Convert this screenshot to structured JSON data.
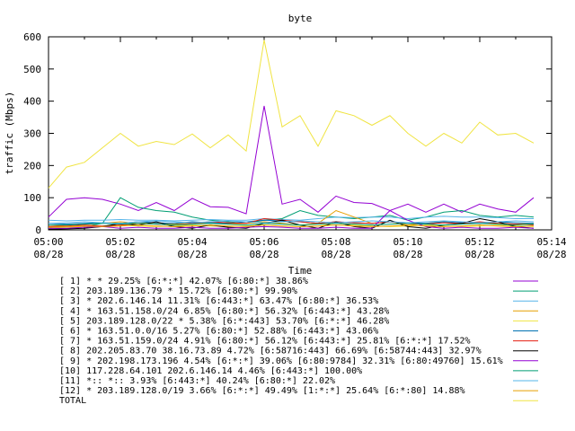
{
  "chart_data": {
    "type": "line",
    "title": "byte",
    "xlabel": "Time",
    "ylabel": "traffic (Mbps)",
    "ylim": [
      0,
      600
    ],
    "xlim": [
      0,
      14
    ],
    "grid": false,
    "legend_placement": "bottom",
    "y_ticks": [
      "0",
      "100",
      "200",
      "300",
      "400",
      "500",
      "600"
    ],
    "x_ticks": [
      {
        "time": "05:00",
        "date": "08/28"
      },
      {
        "time": "05:02",
        "date": "08/28"
      },
      {
        "time": "05:04",
        "date": "08/28"
      },
      {
        "time": "05:06",
        "date": "08/28"
      },
      {
        "time": "05:08",
        "date": "08/28"
      },
      {
        "time": "05:10",
        "date": "08/28"
      },
      {
        "time": "05:12",
        "date": "08/28"
      },
      {
        "time": "05:14",
        "date": "08/28"
      }
    ],
    "x": [
      0,
      0.5,
      1,
      1.5,
      2,
      2.5,
      3,
      3.5,
      4,
      4.5,
      5,
      5.5,
      6,
      6.5,
      7,
      7.5,
      8,
      8.5,
      9,
      9.5,
      10,
      10.5,
      11,
      11.5,
      12,
      12.5,
      13,
      13.5
    ],
    "series": [
      {
        "name": "[ 1] * * 29.25%  [6:*:*] 42.07% [6:80:*] 38.86%",
        "color": "#9400d3",
        "values": [
          40,
          95,
          100,
          95,
          80,
          60,
          85,
          60,
          98,
          72,
          70,
          50,
          385,
          80,
          95,
          55,
          105,
          85,
          82,
          60,
          80,
          55,
          80,
          55,
          80,
          65,
          55,
          100
        ]
      },
      {
        "name": "[ 2] 203.189.136.79 * 15.72%  [6:80:*] 99.90%",
        "color": "#009e73",
        "values": [
          5,
          8,
          10,
          20,
          100,
          70,
          60,
          55,
          40,
          30,
          25,
          20,
          30,
          35,
          60,
          45,
          40,
          35,
          40,
          45,
          30,
          40,
          55,
          60,
          45,
          40,
          45,
          40
        ]
      },
      {
        "name": "[ 3] * 202.6.146.14 11.31%  [6:443:*] 63.47% [6:80:*] 36.53%",
        "color": "#56b4e9",
        "values": [
          30,
          28,
          30,
          30,
          32,
          30,
          30,
          28,
          30,
          32,
          30,
          30,
          35,
          32,
          30,
          35,
          40,
          38,
          40,
          40,
          35,
          40,
          42,
          40,
          40,
          38,
          35,
          35
        ]
      },
      {
        "name": "[ 4] * 163.51.158.0/24 6.85%  [6:80:*] 56.32% [6:443:*] 43.28%",
        "color": "#e69f00",
        "values": [
          10,
          15,
          18,
          20,
          25,
          20,
          22,
          18,
          20,
          22,
          18,
          20,
          25,
          20,
          15,
          20,
          60,
          40,
          20,
          25,
          15,
          20,
          25,
          20,
          22,
          20,
          18,
          20
        ]
      },
      {
        "name": "[ 5] 203.189.128.0/22 * 5.38%  [6:*:443] 53.70% [6:*:*] 46.28%",
        "color": "#f0e442",
        "values": [
          5,
          8,
          10,
          12,
          15,
          12,
          10,
          12,
          15,
          12,
          10,
          12,
          15,
          12,
          10,
          12,
          20,
          15,
          12,
          10,
          12,
          15,
          12,
          10,
          12,
          15,
          12,
          10
        ]
      },
      {
        "name": "[ 6] * 163.51.0.0/16 5.27%  [6:80:*] 52.88% [6:443:*] 43.06%",
        "color": "#0072b2",
        "values": [
          20,
          18,
          20,
          22,
          20,
          25,
          22,
          20,
          25,
          22,
          20,
          25,
          30,
          28,
          25,
          20,
          25,
          22,
          20,
          25,
          22,
          20,
          25,
          22,
          20,
          25,
          22,
          20
        ]
      },
      {
        "name": "[ 7] * 163.51.159.0/24 4.91%  [6:80:*] 56.12% [6:443:*] 25.81% [6:*:*] 17.52%",
        "color": "#e51e10",
        "values": [
          10,
          12,
          15,
          12,
          15,
          20,
          18,
          15,
          20,
          25,
          22,
          20,
          35,
          30,
          25,
          20,
          25,
          22,
          20,
          25,
          20,
          18,
          22,
          20,
          25,
          20,
          18,
          15
        ]
      },
      {
        "name": "[ 8] 202.205.83.70 38.16.73.89 4.72%  [6:58716:443] 66.69% [6:58744:443] 32.97%",
        "color": "#000000",
        "values": [
          2,
          3,
          5,
          10,
          20,
          15,
          25,
          10,
          5,
          15,
          8,
          5,
          20,
          30,
          15,
          5,
          25,
          10,
          5,
          30,
          10,
          5,
          15,
          20,
          35,
          25,
          10,
          5
        ]
      },
      {
        "name": "[ 9] * 202.198.173.196 4.54%  [6:*:*] 39.06% [6:80:9784] 32.31% [6:80:49760] 15.61%",
        "color": "#9400d3",
        "values": [
          5,
          5,
          8,
          10,
          5,
          8,
          5,
          5,
          8,
          5,
          5,
          8,
          10,
          8,
          5,
          5,
          8,
          5,
          5,
          60,
          30,
          10,
          5,
          8,
          5,
          5,
          8,
          5
        ]
      },
      {
        "name": "[10] 117.228.64.101 202.6.146.14 4.46%  [6:443:*] 100.00%",
        "color": "#009e73",
        "values": [
          15,
          15,
          18,
          20,
          18,
          20,
          18,
          15,
          18,
          20,
          18,
          15,
          20,
          18,
          15,
          18,
          20,
          18,
          15,
          18,
          20,
          18,
          15,
          18,
          20,
          18,
          15,
          18
        ]
      },
      {
        "name": "[11] *:: *:: 3.93%  [6:443:*] 40.24% [6:80:*] 22.02%",
        "color": "#56b4e9",
        "values": [
          20,
          22,
          25,
          22,
          20,
          25,
          28,
          25,
          22,
          25,
          28,
          25,
          22,
          25,
          28,
          25,
          22,
          25,
          28,
          25,
          22,
          25,
          28,
          25,
          22,
          25,
          28,
          25
        ]
      },
      {
        "name": "[12] * 203.189.128.0/19 3.66%  [6:*:*] 49.49% [1:*:*] 25.64% [6:*:80] 14.88%",
        "color": "#e69f00",
        "values": [
          8,
          10,
          12,
          10,
          12,
          15,
          12,
          10,
          12,
          15,
          12,
          10,
          15,
          12,
          10,
          12,
          15,
          12,
          10,
          12,
          15,
          12,
          10,
          12,
          15,
          12,
          10,
          12
        ]
      },
      {
        "name": "TOTAL",
        "color": "#f0e442",
        "values": [
          130,
          195,
          210,
          255,
          300,
          260,
          275,
          265,
          298,
          255,
          295,
          245,
          590,
          320,
          355,
          260,
          370,
          355,
          325,
          355,
          300,
          260,
          300,
          270,
          335,
          295,
          300,
          270
        ]
      }
    ]
  }
}
